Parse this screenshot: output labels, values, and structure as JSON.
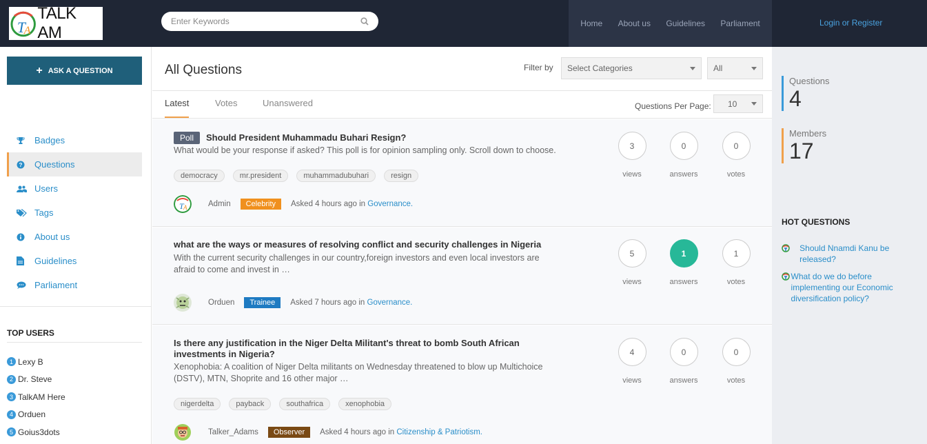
{
  "header": {
    "logo_text": "TALK AM",
    "search_placeholder": "Enter Keywords",
    "nav": [
      "Home",
      "About us",
      "Guidelines",
      "Parliament"
    ],
    "login": "Login or Register"
  },
  "sidebar": {
    "ask_button": "ASK A QUESTION",
    "items": [
      {
        "label": "Badges",
        "icon": "trophy-icon"
      },
      {
        "label": "Questions",
        "icon": "question-circle-icon"
      },
      {
        "label": "Users",
        "icon": "users-icon"
      },
      {
        "label": "Tags",
        "icon": "tags-icon"
      },
      {
        "label": "About us",
        "icon": "info-circle-icon"
      },
      {
        "label": "Guidelines",
        "icon": "document-icon"
      },
      {
        "label": "Parliament",
        "icon": "chat-bubble-icon"
      }
    ],
    "top_users_title": "TOP USERS",
    "top_users": [
      {
        "rank": "1",
        "name": "Lexy B"
      },
      {
        "rank": "2",
        "name": "Dr. Steve"
      },
      {
        "rank": "3",
        "name": "TalkAM Here"
      },
      {
        "rank": "4",
        "name": "Orduen"
      },
      {
        "rank": "5",
        "name": "Goius3dots"
      }
    ]
  },
  "main": {
    "title": "All Questions",
    "filter_label": "Filter by",
    "category_select": "Select Categories",
    "all_select": "All",
    "tabs": [
      "Latest",
      "Votes",
      "Unanswered"
    ],
    "per_page_label": "Questions Per Page:",
    "per_page_value": "10",
    "questions": [
      {
        "poll": "Poll",
        "title": "Should President Muhammadu Buhari Resign?",
        "excerpt": "What would be your response if asked? This poll is for opinion sampling only. Scroll down to choose.",
        "tags": [
          "democracy",
          "mr.president",
          "muhammadubuhari",
          "resign"
        ],
        "author": "Admin",
        "badge": "Celebrity",
        "badge_color": "#f0901e",
        "asked": "Asked 4 hours ago in",
        "category": "Governance.",
        "views": "3",
        "answers": "0",
        "votes": "0"
      },
      {
        "title": "what are the ways or measures of resolving conflict and security challenges in Nigeria",
        "excerpt": "With the current security challenges in our country,foreign investors and even local investors are afraid to come and invest in …",
        "author": "Orduen",
        "badge": "Trainee",
        "badge_color": "#1f7bc2",
        "asked": "Asked 7 hours ago in",
        "category": "Governance.",
        "views": "5",
        "answers": "1",
        "votes": "1"
      },
      {
        "title": "Is there any justification in the Niger Delta Militant's threat to bomb South African investments in Nigeria?",
        "excerpt": "Xenophobia: A coalition of Niger Delta militants on Wednesday threatened to blow up Multichoice (DSTV), MTN, Shoprite and 16 other major …",
        "tags": [
          "nigerdelta",
          "payback",
          "southafrica",
          "xenophobia"
        ],
        "author": "Talker_Adams",
        "badge": "Observer",
        "badge_color": "#7a4a14",
        "asked": "Asked 4 hours ago in",
        "category": "Citizenship & Patriotism.",
        "views": "4",
        "answers": "0",
        "votes": "0"
      }
    ],
    "stat_labels": {
      "views": "views",
      "answers": "answers",
      "votes": "votes"
    }
  },
  "right": {
    "questions_label": "Questions",
    "questions_count": "4",
    "members_label": "Members",
    "members_count": "17",
    "hot_title": "HOT QUESTIONS",
    "hot": [
      "Should Nnamdi Kanu be released?",
      "What do we do before implementing our Economic diversification policy?"
    ]
  },
  "colors": {
    "accent": "#f0a04b",
    "link": "#2a8ec9",
    "header": "#1f2635",
    "answered": "#27b898"
  }
}
